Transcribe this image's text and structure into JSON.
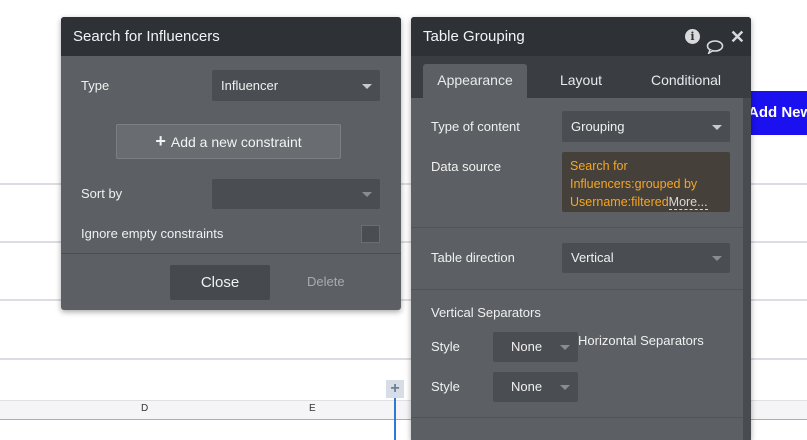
{
  "canvas": {
    "add_new_label": "Add New",
    "columns": [
      "D",
      "E"
    ],
    "add_column_symbol": "+"
  },
  "search_panel": {
    "title": "Search for Influencers",
    "type_label": "Type",
    "type_value": "Influencer",
    "add_constraint_label": "Add a new constraint",
    "add_constraint_symbol": "+",
    "sort_by_label": "Sort by",
    "sort_by_value": "",
    "ignore_empty_label": "Ignore empty constraints",
    "ignore_empty_checked": false,
    "close_label": "Close",
    "delete_label": "Delete"
  },
  "grouping_panel": {
    "title": "Table Grouping",
    "icons": [
      "info-icon",
      "comment-icon",
      "close-icon"
    ],
    "tabs": [
      {
        "label": "Appearance",
        "active": true
      },
      {
        "label": "Layout",
        "active": false
      },
      {
        "label": "Conditional",
        "active": false
      }
    ],
    "type_of_content_label": "Type of content",
    "type_of_content_value": "Grouping",
    "data_source_label": "Data source",
    "data_source_value": "Search for Influencers:grouped by Username:filtered",
    "data_source_more": "More...",
    "table_direction_label": "Table direction",
    "table_direction_value": "Vertical",
    "vertical_separators_label": "Vertical Separators",
    "horizontal_separators_label": "Horizontal Separators",
    "style_label": "Style",
    "vertical_style_value": "None",
    "horizontal_style_value": "None"
  },
  "colors": {
    "panel_bg": "#5c6064",
    "header_bg": "#2e3236",
    "accent_blue": "#1a10f0",
    "data_source_text": "#f5a623"
  }
}
